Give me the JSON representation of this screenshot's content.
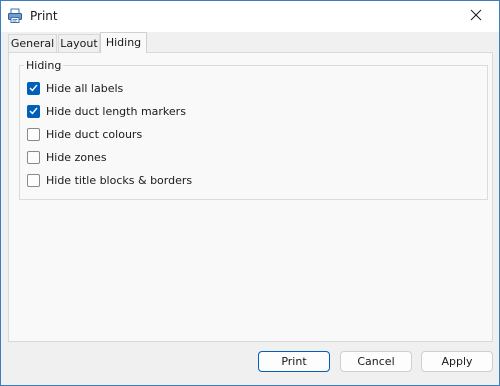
{
  "window": {
    "title": "Print",
    "app_icon": "printer-icon",
    "close_icon": "close-icon"
  },
  "tabs": [
    {
      "label": "General",
      "active": false
    },
    {
      "label": "Layout",
      "active": false
    },
    {
      "label": "Hiding",
      "active": true
    }
  ],
  "hiding": {
    "group_label": "Hiding",
    "options": [
      {
        "label": "Hide all labels",
        "checked": true
      },
      {
        "label": "Hide duct length markers",
        "checked": true
      },
      {
        "label": "Hide duct colours",
        "checked": false
      },
      {
        "label": "Hide zones",
        "checked": false
      },
      {
        "label": "Hide title blocks & borders",
        "checked": false
      }
    ]
  },
  "buttons": {
    "print": "Print",
    "cancel": "Cancel",
    "apply": "Apply"
  },
  "colors": {
    "accent": "#005fb8",
    "window_border": "#3a7ebf",
    "dialog_bg": "#f0f0f0",
    "panel_bg": "#f9f9f9"
  }
}
